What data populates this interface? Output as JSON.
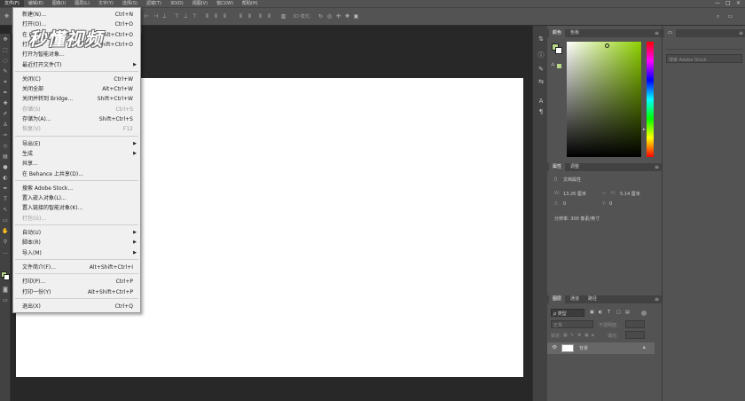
{
  "menubar": {
    "items": [
      "文件(F)",
      "编辑(E)",
      "图像(I)",
      "图层(L)",
      "文字(Y)",
      "选择(S)",
      "滤镜(T)",
      "3D(D)",
      "视图(V)",
      "窗口(W)",
      "帮助(H)"
    ],
    "window_controls": [
      "—",
      "□",
      "×"
    ]
  },
  "optionsbar": {
    "mode_label": "3D 模式:"
  },
  "watermark": "秒懂视频",
  "file_menu": {
    "items": [
      {
        "label": "新建(N)...",
        "shortcut": "Ctrl+N"
      },
      {
        "label": "打开(O)...",
        "shortcut": "Ctrl+O"
      },
      {
        "label": "在 Bridge 中浏览(B)...",
        "shortcut": "Alt+Ctrl+O"
      },
      {
        "label": "打开为...",
        "shortcut": "Alt+Shift+Ctrl+O"
      },
      {
        "label": "打开为智能对象...",
        "shortcut": ""
      },
      {
        "label": "最近打开文件(T)",
        "shortcut": "",
        "submenu": true
      },
      {
        "label": "关闭(C)",
        "shortcut": "Ctrl+W"
      },
      {
        "label": "关闭全部",
        "shortcut": "Alt+Ctrl+W"
      },
      {
        "label": "关闭并转到 Bridge...",
        "shortcut": "Shift+Ctrl+W"
      },
      {
        "label": "存储(S)",
        "shortcut": "Ctrl+S",
        "disabled": true
      },
      {
        "label": "存储为(A)...",
        "shortcut": "Shift+Ctrl+S"
      },
      {
        "label": "恢复(V)",
        "shortcut": "F12",
        "disabled": true
      },
      {
        "label": "导出(E)",
        "shortcut": "",
        "submenu": true
      },
      {
        "label": "生成",
        "shortcut": "",
        "submenu": true
      },
      {
        "label": "共享...",
        "shortcut": ""
      },
      {
        "label": "在 Behance 上共享(D)...",
        "shortcut": ""
      },
      {
        "label": "搜索 Adobe Stock...",
        "shortcut": ""
      },
      {
        "label": "置入嵌入对象(L)...",
        "shortcut": ""
      },
      {
        "label": "置入链接的智能对象(K)...",
        "shortcut": ""
      },
      {
        "label": "打包(G)...",
        "shortcut": "",
        "disabled": true
      },
      {
        "label": "自动(U)",
        "shortcut": "",
        "submenu": true
      },
      {
        "label": "脚本(R)",
        "shortcut": "",
        "submenu": true
      },
      {
        "label": "导入(M)",
        "shortcut": "",
        "submenu": true
      },
      {
        "label": "文件简介(F)...",
        "shortcut": "Alt+Shift+Ctrl+I"
      },
      {
        "label": "打印(P)...",
        "shortcut": "Ctrl+P"
      },
      {
        "label": "打印一份(Y)",
        "shortcut": "Alt+Shift+Ctrl+P"
      },
      {
        "label": "退出(X)",
        "shortcut": "Ctrl+Q"
      }
    ]
  },
  "color_panel": {
    "tabs": [
      "颜色",
      "色板"
    ],
    "foreground": "#b8d98a",
    "background": "#ffffff"
  },
  "properties_panel": {
    "tabs": [
      "属性",
      "调整"
    ],
    "doc_label": "文档属性",
    "w_label": "W:",
    "w_value": "13.26 厘米",
    "h_label": "H:",
    "h_value": "5.14 厘米",
    "x_label": "X:",
    "x_value": "0",
    "y_label": "Y:",
    "y_value": "0",
    "resolution": "分辨率: 300 像素/英寸"
  },
  "layers_panel": {
    "tabs": [
      "图层",
      "通道",
      "路径"
    ],
    "filter_label": "ρ 类型",
    "blend_mode": "正常",
    "opacity_label": "不透明度:",
    "lock_label": "锁定:",
    "fill_label": "填充:",
    "layer_name": "背景"
  },
  "libraries": {
    "search_placeholder": "搜索 Adobe Stock"
  }
}
